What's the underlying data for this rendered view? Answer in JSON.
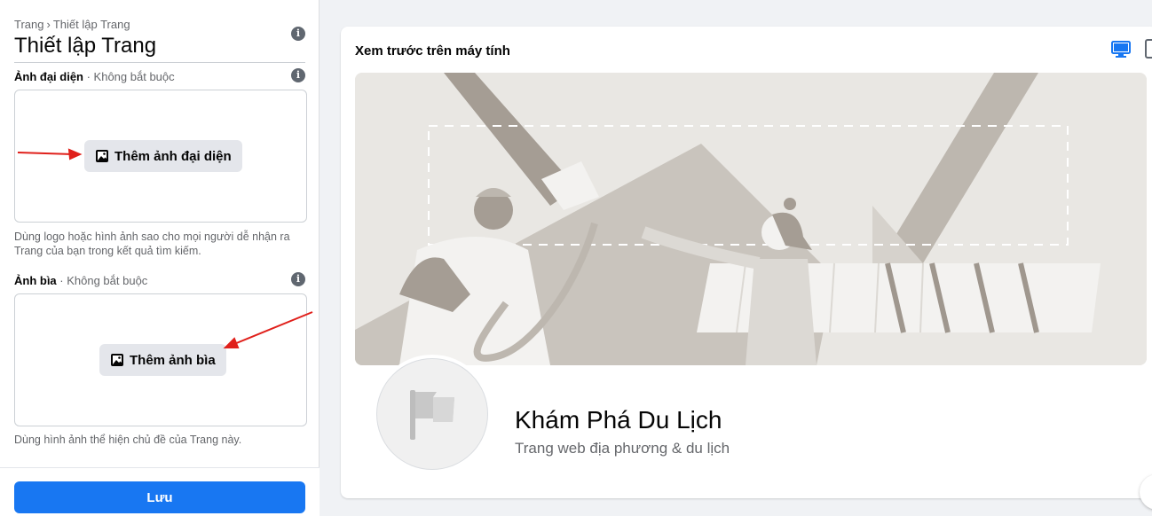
{
  "breadcrumb": {
    "parent": "Trang",
    "separator": "›",
    "current": "Thiết lập Trang"
  },
  "page_title": "Thiết lập Trang",
  "profile_photo": {
    "label": "Ảnh đại diện",
    "optional": " · Không bắt buộc",
    "button": "Thêm ảnh đại diện",
    "help": "Dùng logo hoặc hình ảnh sao cho mọi người dễ nhận ra Trang của bạn trong kết quả tìm kiếm."
  },
  "cover_photo": {
    "label": "Ảnh bìa",
    "optional": " · Không bắt buộc",
    "button": "Thêm ảnh bìa",
    "help": "Dùng hình ảnh thể hiện chủ đề của Trang này."
  },
  "save_button": "Lưu",
  "preview": {
    "title": "Xem trước trên máy tính",
    "page_name": "Khám Phá Du Lịch",
    "page_category": "Trang web địa phương & du lịch"
  },
  "colors": {
    "primary": "#1877f2",
    "annotation_arrow": "#e0201b"
  },
  "icons": {
    "info": "info-icon",
    "photo": "photo-icon",
    "desktop": "desktop-icon",
    "mobile": "mobile-icon",
    "flag": "flag-icon"
  }
}
